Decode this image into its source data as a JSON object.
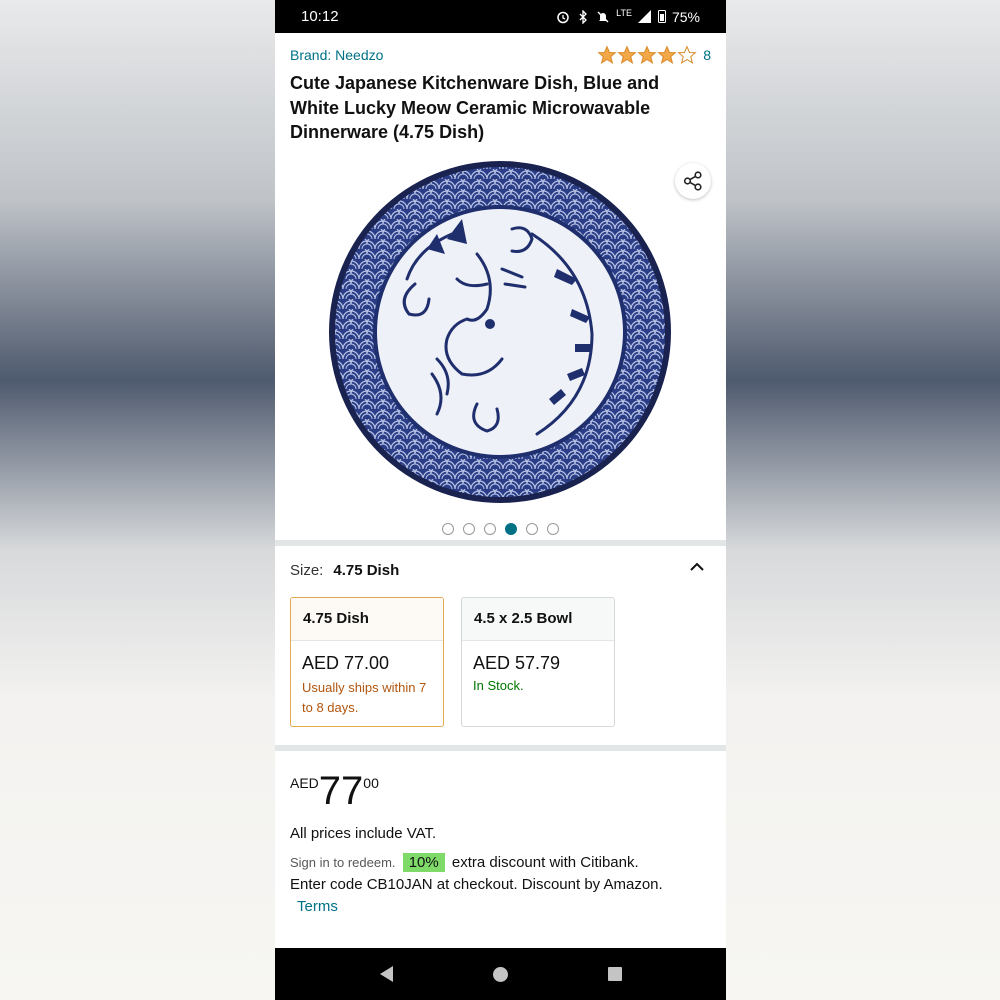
{
  "status": {
    "time": "10:12",
    "network": "LTE",
    "battery": "75%"
  },
  "product": {
    "brand": "Brand: Needzo",
    "rating_stars": 4,
    "rating_count": "8",
    "title": "Cute Japanese Kitchenware Dish, Blue and White Lucky Meow Ceramic Microwavable Dinnerware (4.75 Dish)",
    "image_count": 6,
    "active_image_index": 3
  },
  "size": {
    "label": "Size:",
    "value": "4.75 Dish",
    "options": [
      {
        "name": "4.75 Dish",
        "price": "AED 77.00",
        "availability": "Usually ships within 7 to 8 days.",
        "selected": true
      },
      {
        "name": "4.5 x 2.5 Bowl",
        "price": "AED 57.79",
        "availability": "In Stock.",
        "selected": false
      }
    ]
  },
  "price": {
    "currency": "AED",
    "whole": "77",
    "fraction": "00",
    "vat_note": "All prices include VAT."
  },
  "promo": {
    "signin": "Sign in to redeem.",
    "badge": "10%",
    "text1": "extra discount with Citibank.",
    "text2": "Enter code CB10JAN at checkout. Discount by Amazon.",
    "terms": "Terms"
  },
  "colors": {
    "link": "#007185",
    "star": "#f3a847",
    "badge_green": "#7fda69",
    "ship_orange": "#b1560f",
    "stock_green": "#007600"
  },
  "icons": [
    "alarm-icon",
    "bluetooth-icon",
    "mute-icon",
    "signal-icon",
    "battery-icon",
    "share-icon",
    "chevron-up-icon",
    "back-icon",
    "home-icon",
    "recents-icon"
  ]
}
